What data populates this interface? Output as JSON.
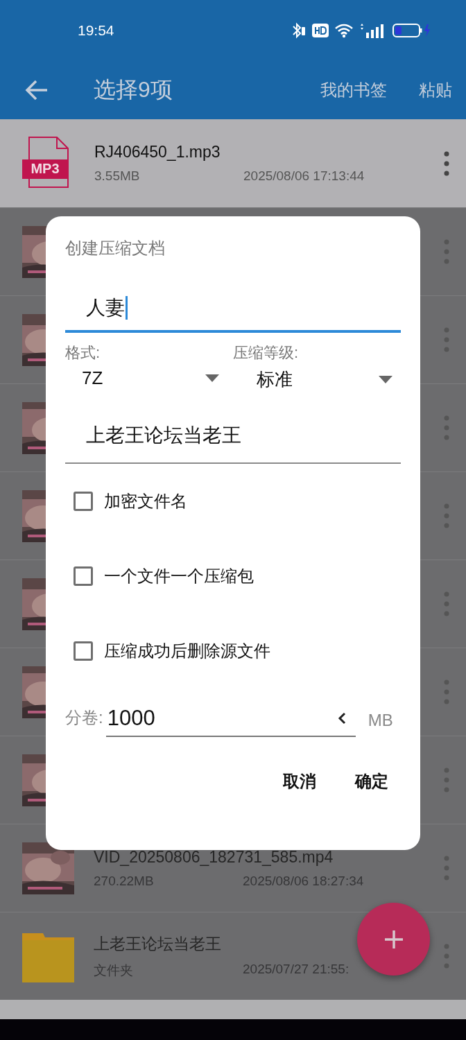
{
  "status_bar": {
    "time": "19:54"
  },
  "toolbar": {
    "title": "选择9项",
    "actions": [
      "我的书签",
      "粘贴"
    ]
  },
  "files": [
    {
      "kind": "mp3",
      "icon_label": "MP3",
      "name": "RJ406450_1.mp3",
      "size": "3.55MB",
      "date": "2025/08/06 17:13:44"
    },
    {
      "kind": "video"
    },
    {
      "kind": "video"
    },
    {
      "kind": "video"
    },
    {
      "kind": "video"
    },
    {
      "kind": "video"
    },
    {
      "kind": "video"
    },
    {
      "kind": "video"
    },
    {
      "kind": "video",
      "name": "VID_20250806_182731_585.mp4",
      "size": "270.22MB",
      "date": "2025/08/06 18:27:34"
    },
    {
      "kind": "folder",
      "name": "上老王论坛当老王",
      "size": "文件夹",
      "date": "2025/07/27 21:55:"
    }
  ],
  "dialog": {
    "title": "创建压缩文档",
    "name_field": {
      "value": "人妻",
      "focused": true
    },
    "format": {
      "label": "格式:",
      "value": "7Z"
    },
    "level": {
      "label": "压缩等级:",
      "value": "标准"
    },
    "comment_field": {
      "value": "上老王论坛当老王",
      "focused": false
    },
    "options": [
      {
        "label": "加密文件名",
        "checked": false
      },
      {
        "label": "一个文件一个压缩包",
        "checked": false
      },
      {
        "label": "压缩成功后删除源文件",
        "checked": false
      }
    ],
    "split": {
      "label": "分卷:",
      "value": "1000",
      "unit": "MB"
    },
    "buttons": [
      "取消",
      "确定"
    ]
  }
}
